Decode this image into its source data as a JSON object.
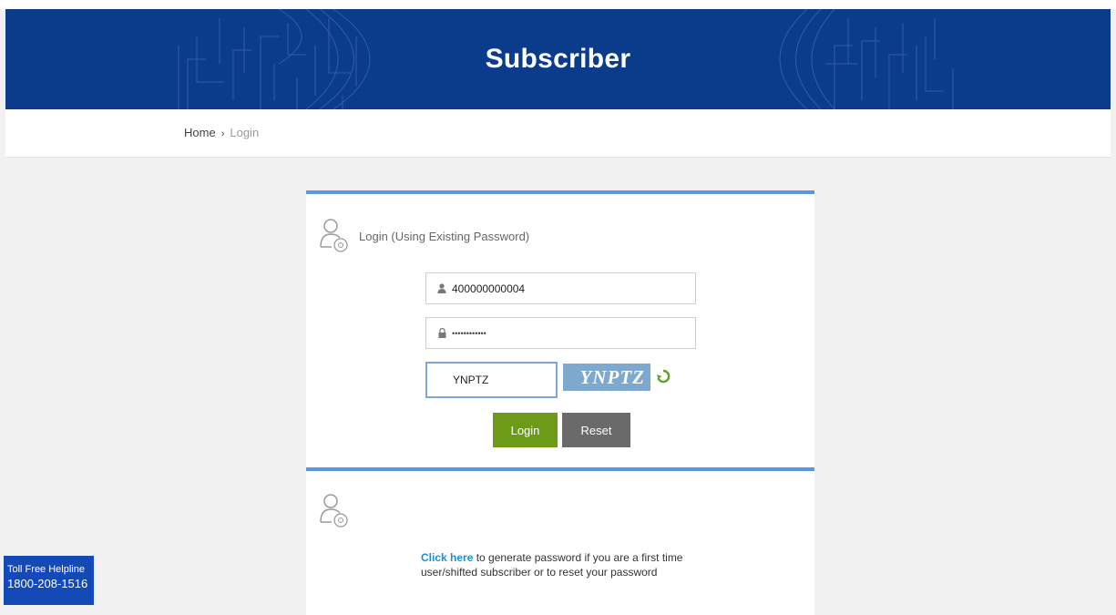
{
  "header": {
    "title": "Subscriber"
  },
  "breadcrumb": {
    "home": "Home",
    "separator": "›",
    "current": "Login"
  },
  "login_panel": {
    "heading": "Login  (Using Existing Password)",
    "user_field": {
      "value": "400000000004",
      "icon": "user-icon"
    },
    "password_field": {
      "value": "••••••••••••",
      "icon": "lock-icon"
    },
    "captcha_input": {
      "value": "YNPTZ"
    },
    "captcha_image_text": "YNPTZ",
    "login_button": "Login",
    "reset_button": "Reset"
  },
  "generate_panel": {
    "link_text": "Click here",
    "text": " to generate password if you are a first time user/shifted subscriber or to reset your password"
  },
  "helpline": {
    "label": "Toll Free Helpline",
    "number": "1800-208-1516"
  },
  "colors": {
    "header_bg": "#0b3c8c",
    "panel_accent": "#5b9bd5",
    "login_button": "#6e9b17",
    "reset_button": "#6a6a6a",
    "link": "#1a8fd6",
    "helpline_bg": "#1449b8"
  }
}
